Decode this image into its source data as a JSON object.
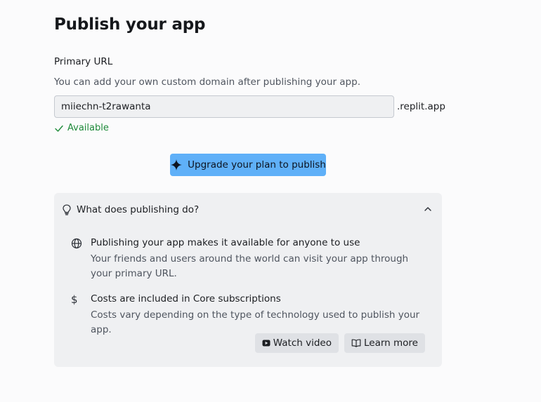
{
  "page": {
    "title": "Publish your app"
  },
  "primary_url": {
    "label": "Primary URL",
    "helper": "You can add your own custom domain after publishing your app.",
    "value": "miiechn-t2rawanta",
    "suffix": ".replit.app",
    "status": "Available",
    "status_icon": "check-icon"
  },
  "upgrade_button": {
    "label": "Upgrade your plan to publish",
    "icon": "sparkle-icon",
    "color": "#5fb0f8"
  },
  "info_panel": {
    "header": "What does publishing do?",
    "header_icon": "lightbulb-icon",
    "toggle_icon": "chevron-up-icon",
    "items": [
      {
        "icon": "globe-icon",
        "title": "Publishing your app makes it available for anyone to use",
        "description": "Your friends and users around the world can visit your app through your primary URL."
      },
      {
        "icon": "dollar-icon",
        "title": "Costs are included in Core subscriptions",
        "description": "Costs vary depending on the type of technology used to publish your app."
      }
    ],
    "actions": {
      "watch_video": "Watch video",
      "learn_more": "Learn more"
    }
  },
  "colors": {
    "available_green": "#1e8a3a",
    "panel_bg": "#eff0f2"
  }
}
